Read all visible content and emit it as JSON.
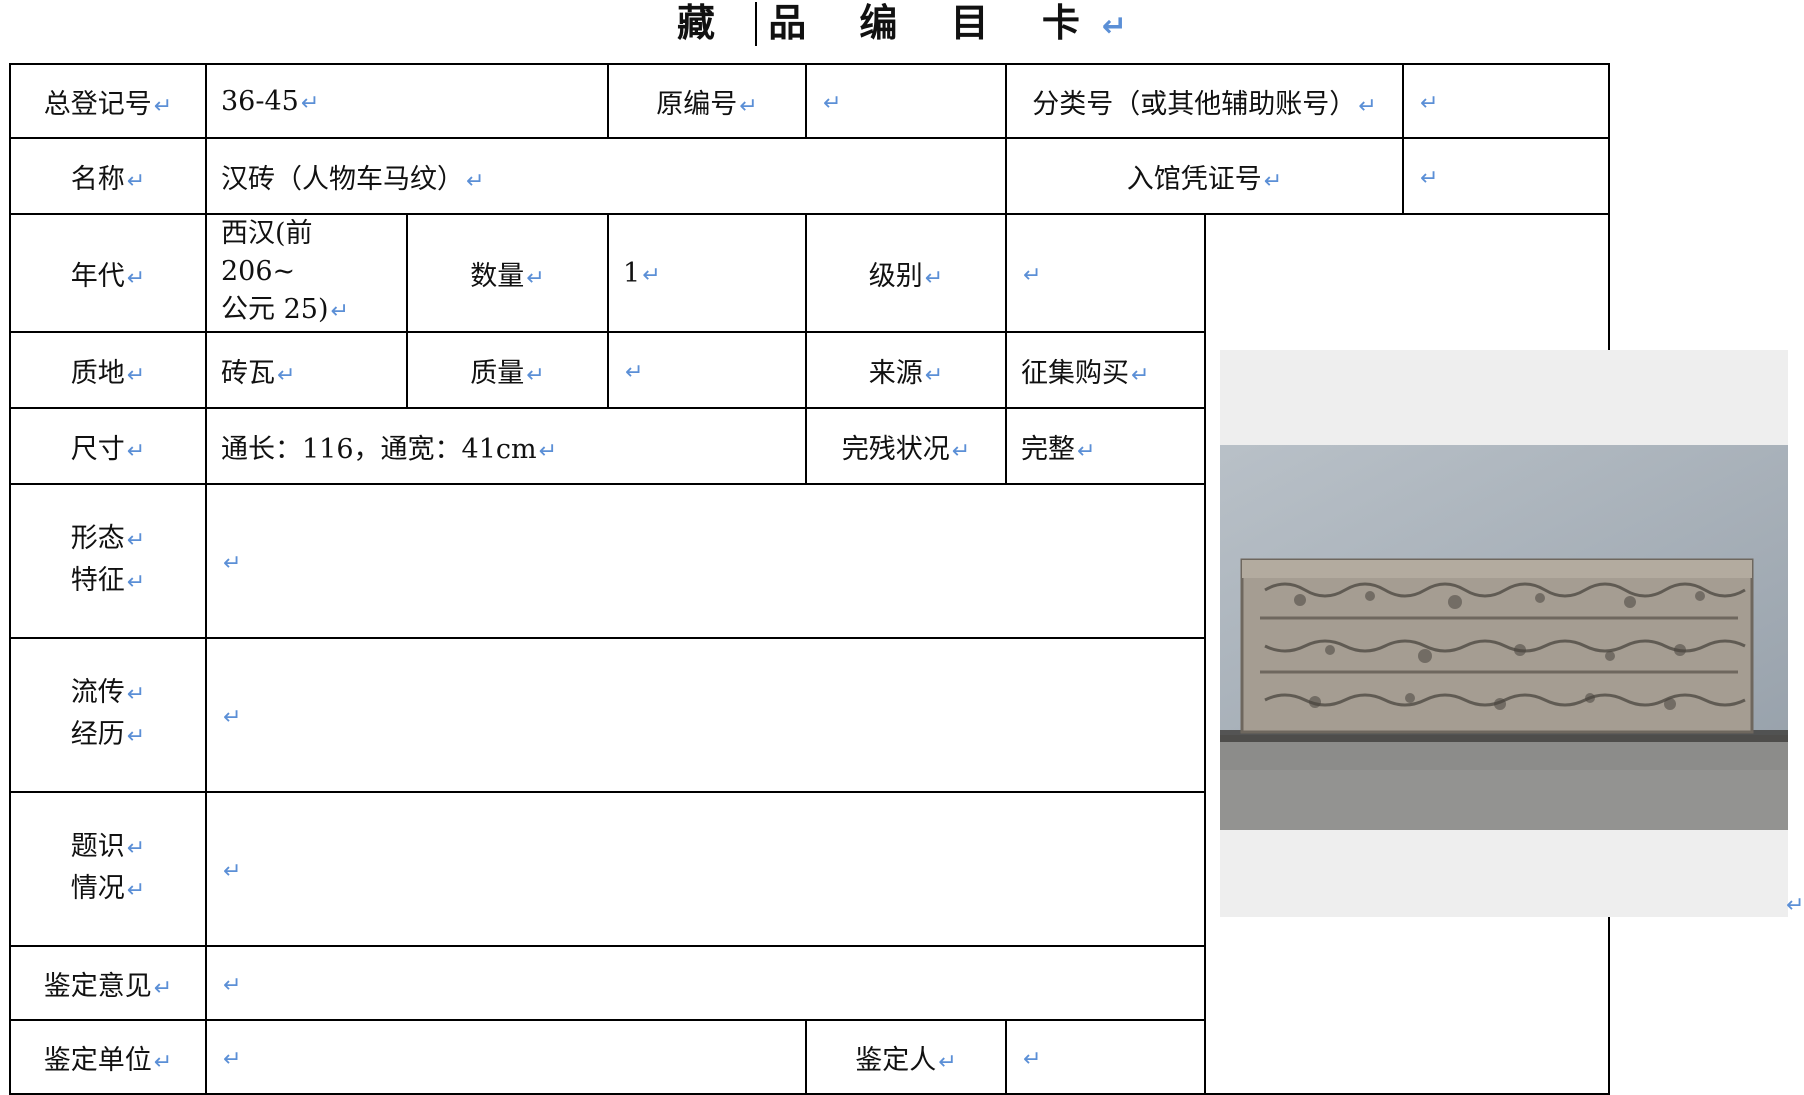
{
  "title": "藏 品 编 目 卡",
  "return_mark": "↵",
  "rows": {
    "reg_no_label": "总登记号",
    "reg_no_value": "36-45",
    "orig_no_label": "原编号",
    "orig_no_value": "",
    "class_no_label": "分类号（或其他辅助账号）",
    "class_no_value": "",
    "name_label": "名称",
    "name_value": "汉砖（人物车马纹）",
    "voucher_label": "入馆凭证号",
    "voucher_value": "",
    "era_label": "年代",
    "era_value_line1": "西汉(前 206~",
    "era_value_line2": "公元 25)",
    "quantity_label": "数量",
    "quantity_value": "1",
    "grade_label": "级别",
    "grade_value": "",
    "material_label": "质地",
    "material_value": "砖瓦",
    "mass_label": "质量",
    "mass_value": "",
    "source_label": "来源",
    "source_value": "征集购买",
    "size_label": "尺寸",
    "size_value": "通长：116，通宽：41cm",
    "condition_label": "完残状况",
    "condition_value": "完整",
    "form_label_1": "形态",
    "form_label_2": "特征",
    "form_value": "",
    "history_label_1": "流传",
    "history_label_2": "经历",
    "history_value": "",
    "inscription_label_1": "题识",
    "inscription_label_2": "情况",
    "inscription_value": "",
    "appraisal_opinion_label": "鉴定意见",
    "appraisal_opinion_value": "",
    "appraisal_unit_label": "鉴定单位",
    "appraisal_unit_value": "",
    "appraiser_label": "鉴定人",
    "appraiser_value": ""
  },
  "colors": {
    "return_mark": "#5b8fd6",
    "photo_bg": "#eeeeee",
    "wall": "#a9b2bb",
    "brick": "#a59d92",
    "floor": "#8c8c8a"
  },
  "photo_icon": "brick-relief-photo"
}
